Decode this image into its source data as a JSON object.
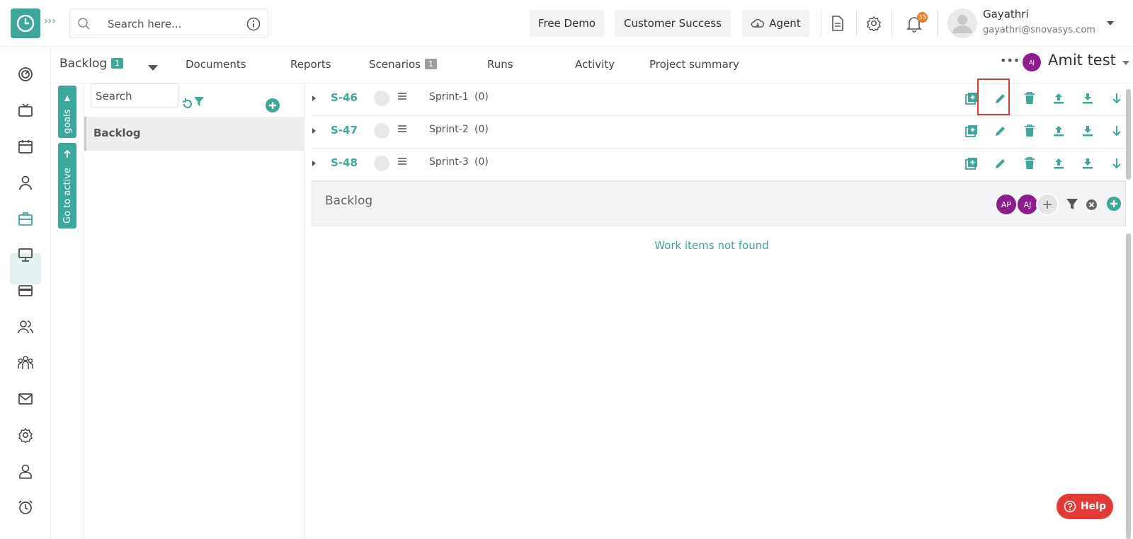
{
  "search": {
    "placeholder": "Search here..."
  },
  "header": {
    "free_demo": "Free Demo",
    "customer_success": "Customer Success",
    "agent": "Agent",
    "notification_count": "35",
    "user_name": "Gayathri",
    "user_email": "gayathri@snovasys.com"
  },
  "tabs": {
    "backlog": "Backlog",
    "backlog_count": "1",
    "documents": "Documents",
    "reports": "Reports",
    "scenarios": "Scenarios",
    "scenarios_count": "1",
    "runs": "Runs",
    "activity": "Activity",
    "project_summary": "Project summary",
    "project_avatar": "AJ",
    "project_name": "Amit test"
  },
  "vertical_tabs": {
    "goals": "goals",
    "go_to_active": "Go to active"
  },
  "goal_panel": {
    "search_placeholder": "Search",
    "selected": "Backlog"
  },
  "sprints": [
    {
      "id": "S-46",
      "name": "Sprint-1",
      "count": "(0)"
    },
    {
      "id": "S-47",
      "name": "Sprint-2",
      "count": "(0)"
    },
    {
      "id": "S-48",
      "name": "Sprint-3",
      "count": "(0)"
    }
  ],
  "backlog_panel": {
    "title": "Backlog",
    "avatars": [
      "AP",
      "AJ"
    ],
    "empty_message": "Work items not found"
  },
  "help": {
    "label": "Help"
  },
  "colors": {
    "accent": "#3aa89a",
    "highlight": "#e53935",
    "avatar": "#8e1c8e",
    "notify": "#f07a1a"
  }
}
